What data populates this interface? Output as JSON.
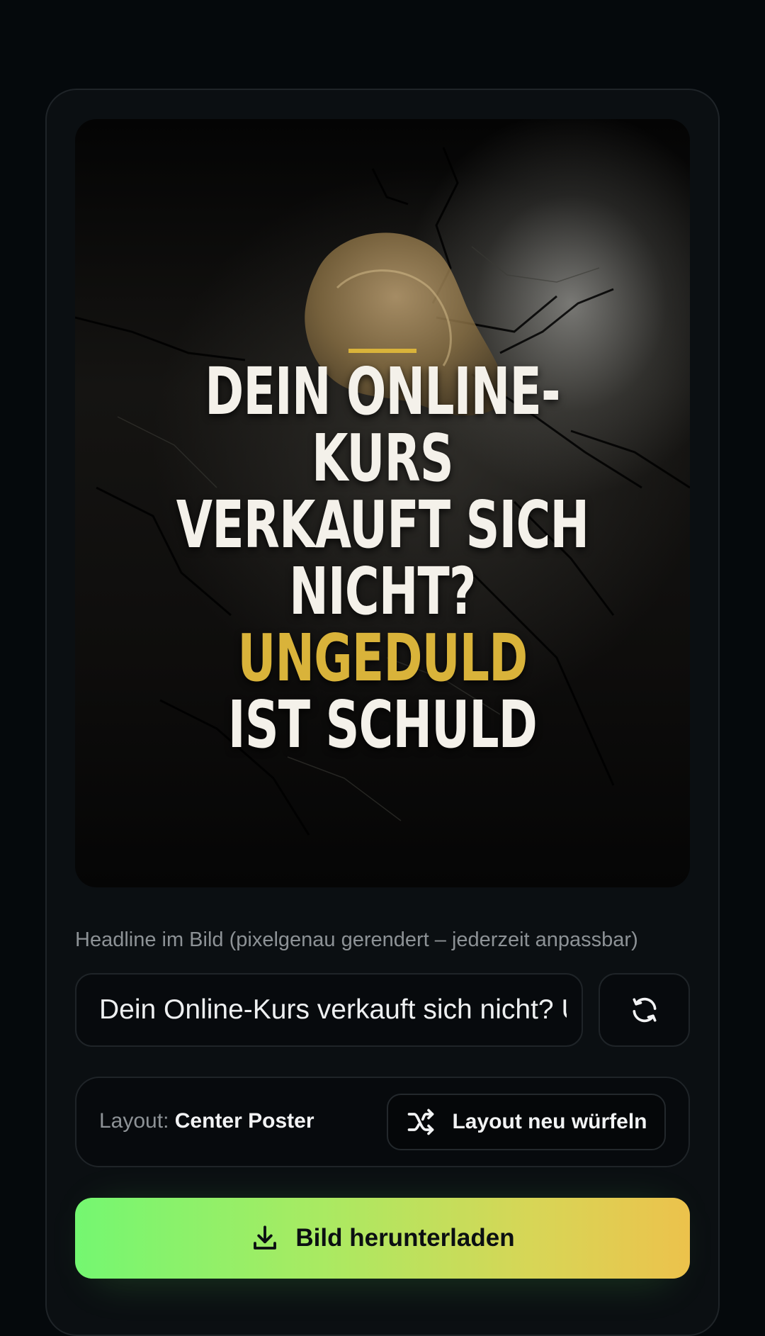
{
  "poster": {
    "headline_line1": "DEIN ONLINE-KURS",
    "headline_line2": "VERKAUFT SICH",
    "headline_line3_prefix": "NICHT? ",
    "headline_line3_highlight": "UNGEDULD",
    "headline_line4": "IST SCHULD",
    "highlight_color": "#d9b33a"
  },
  "headline_field": {
    "label": "Headline im Bild (pixelgenau gerendert – jederzeit anpassbar)",
    "value": "Dein Online-Kurs verkauft sich nicht? Ungeduld ist schuld",
    "refresh_icon": "refresh-icon"
  },
  "layout": {
    "key_label": "Layout:",
    "current": "Center Poster",
    "shuffle_label": "Layout neu würfeln",
    "shuffle_icon": "shuffle-icon"
  },
  "download": {
    "label": "Bild herunterladen",
    "icon": "download-icon",
    "gradient_start": "#74f771",
    "gradient_end": "#ecc24c"
  }
}
